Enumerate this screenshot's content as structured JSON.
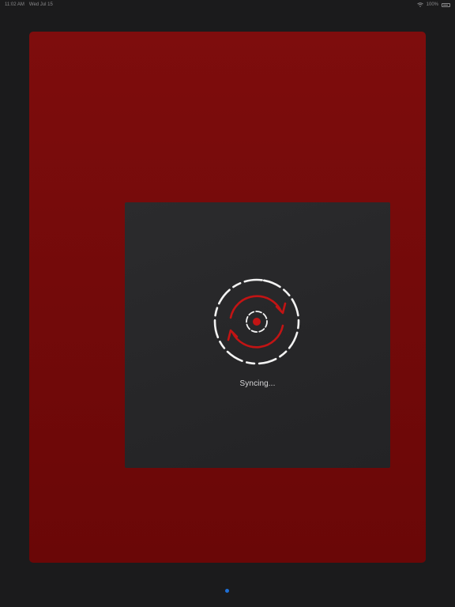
{
  "status_bar": {
    "time": "11:02 AM",
    "date": "Wed Jul 15",
    "battery_text": "100%",
    "wifi_icon": "wifi-icon",
    "battery_icon": "battery-icon"
  },
  "sync_panel": {
    "label": "Syncing...",
    "icon": "sync-icon"
  },
  "page_control": {
    "active_index": 1,
    "total": 1,
    "color": "#1e6fd6"
  },
  "colors": {
    "frame_red": "#7a0b0b",
    "panel": "#282829",
    "accent_red": "#c01414",
    "background": "#1b1b1c"
  }
}
